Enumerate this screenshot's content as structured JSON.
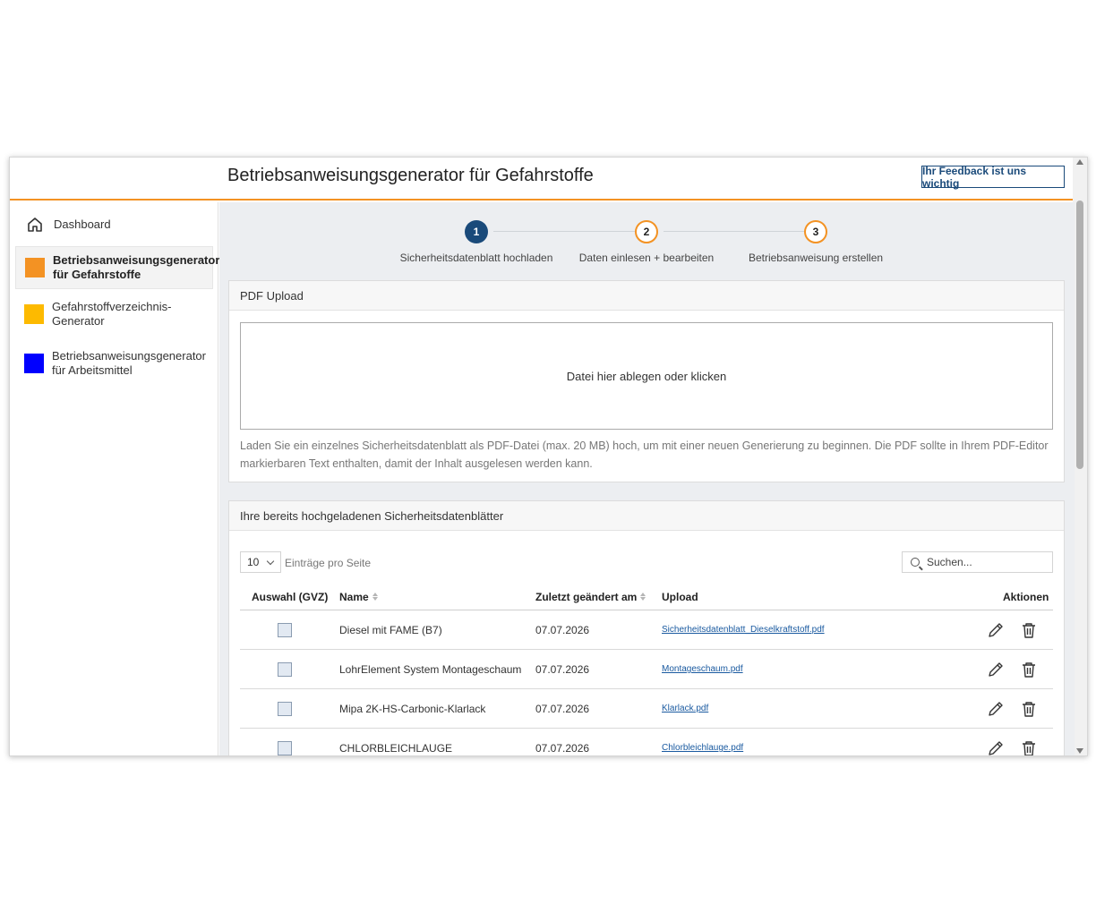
{
  "header": {
    "title": "Betriebsanweisungsgenerator für Gefahrstoffe",
    "feedback_label": "Ihr Feedback ist uns wichtig"
  },
  "sidebar": {
    "items": [
      {
        "label": "Dashboard",
        "icon": "home-icon"
      },
      {
        "label": "Betriebsanweisungsgenerator für Gefahrstoffe",
        "color": "#f39223",
        "active": true
      },
      {
        "label": "Gefahrstoffverzeichnis-Generator",
        "color": "#fdba00"
      },
      {
        "label": "Betriebsanweisungsgenerator für Arbeitsmittel",
        "color": "#0000ff"
      }
    ]
  },
  "stepper": {
    "steps": [
      {
        "number": "1",
        "label": "Sicherheitsdatenblatt hochladen",
        "state": "active"
      },
      {
        "number": "2",
        "label": "Daten einlesen + bearbeiten",
        "state": "pending"
      },
      {
        "number": "3",
        "label": "Betriebsanweisung erstellen",
        "state": "pending"
      }
    ]
  },
  "upload": {
    "title": "PDF Upload",
    "dropzone_text": "Datei hier ablegen oder klicken",
    "hint": "Laden Sie ein einzelnes Sicherheitsdatenblatt als PDF-Datei (max. 20 MB) hoch, um mit einer neuen Generierung zu beginnen. Die PDF sollte in Ihrem PDF-Editor markierbaren Text enthalten, damit der Inhalt ausgelesen werden kann."
  },
  "list": {
    "title": "Ihre bereits hochgeladenen Sicherheitsdatenblätter",
    "page_length": "10",
    "page_length_label": "Einträge pro Seite",
    "search_placeholder": "Suchen...",
    "columns": {
      "select": "Auswahl (GVZ)",
      "name": "Name",
      "modified": "Zuletzt geändert am",
      "upload": "Upload",
      "actions": "Aktionen"
    },
    "rows": [
      {
        "name": "Diesel mit FAME (B7)",
        "modified": "07.07.2026",
        "file": "Sicherheitsdatenblatt_Dieselkraftstoff.pdf"
      },
      {
        "name": "LohrElement System Montageschaum",
        "modified": "07.07.2026",
        "file": "Montageschaum.pdf"
      },
      {
        "name": "Mipa 2K-HS-Carbonic-Klarlack",
        "modified": "07.07.2026",
        "file": "Klarlack.pdf"
      },
      {
        "name": "CHLORBLEICHLAUGE",
        "modified": "07.07.2026",
        "file": "Chlorbleichlauge.pdf"
      }
    ]
  },
  "colors": {
    "accent_orange": "#f39223",
    "primary_blue": "#1a4a7a"
  }
}
